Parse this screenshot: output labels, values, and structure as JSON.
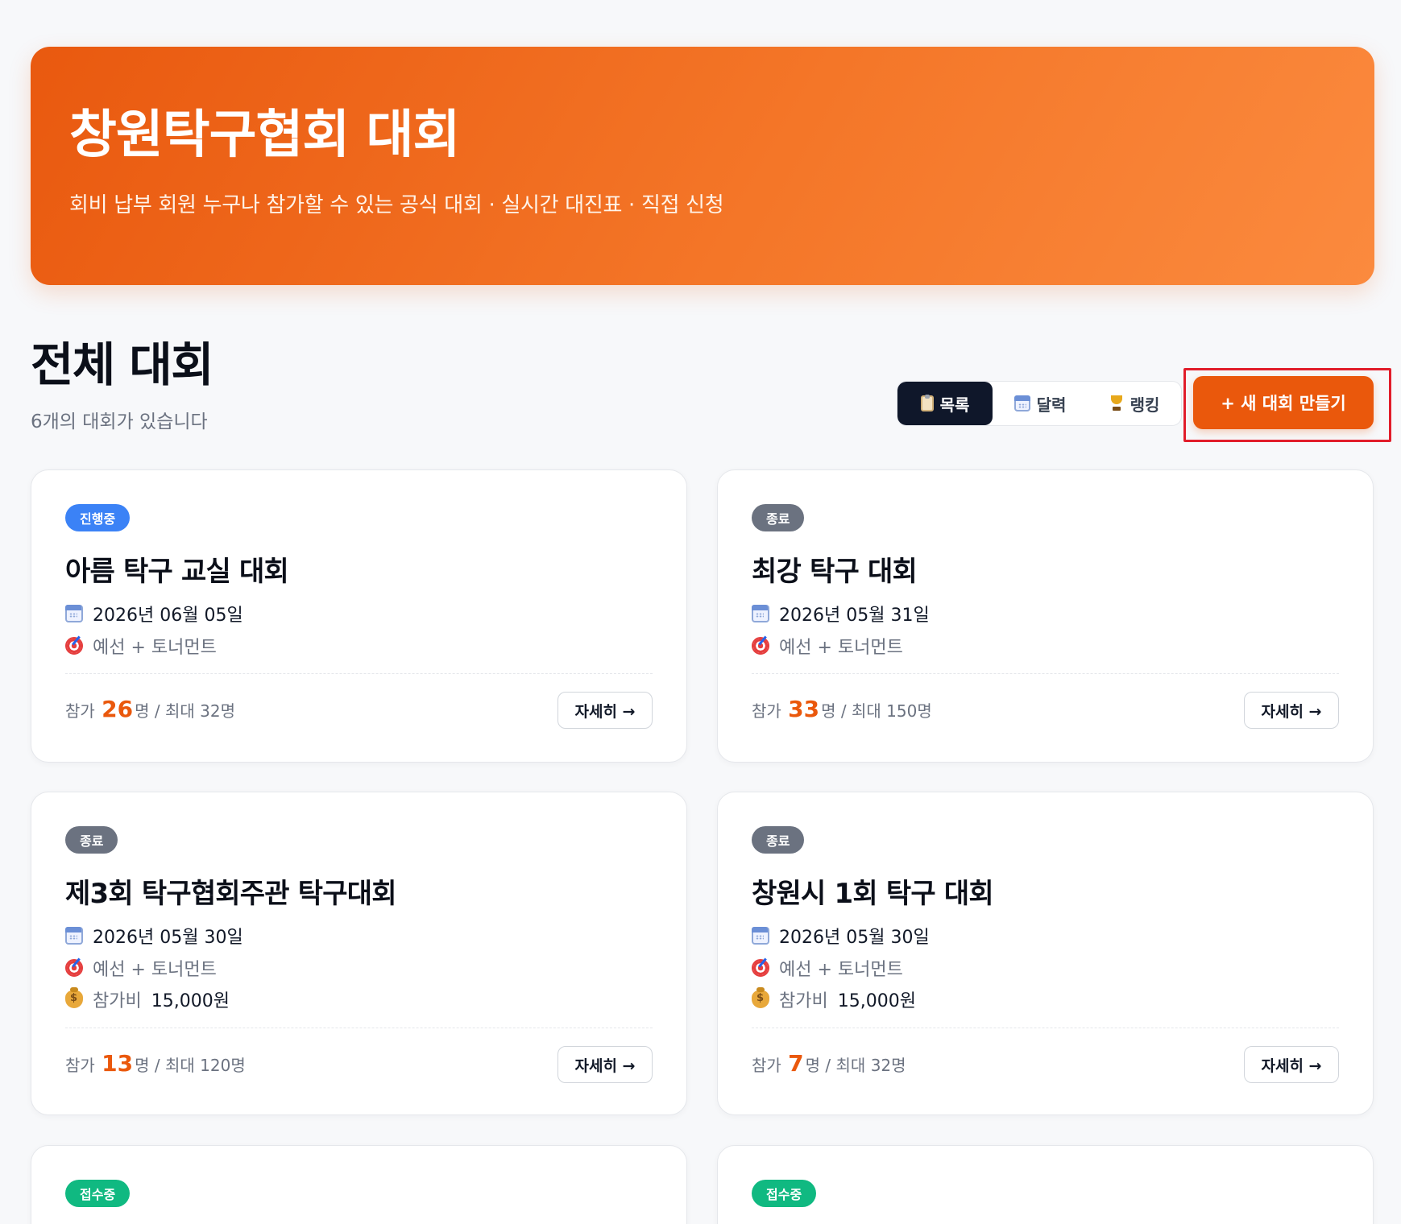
{
  "hero": {
    "title": "창원탁구협회 대회",
    "subtitle": "회비 납부 회원 누구나 참가할 수 있는 공식 대회 · 실시간 대진표 · 직접 신청"
  },
  "section": {
    "title": "전체 대회",
    "count_text": "6개의 대회가 있습니다"
  },
  "view_toggle": {
    "list_label": "목록",
    "calendar_label": "달력",
    "ranking_label": "랭킹",
    "active": "목록"
  },
  "new_button_label": "+ 새 대회 만들기",
  "labels": {
    "participants_prefix": "참가",
    "participants_suffix": "명",
    "max_prefix": "/ 최대",
    "fee_label": "참가비",
    "detail_label": "자세히 →"
  },
  "colors": {
    "accent": "#ea580c",
    "status_live": "#3b82f6",
    "status_done": "#6b7280",
    "status_open": "#10b981",
    "highlight": "#e11d2a"
  },
  "cards": [
    {
      "status": "진행중",
      "title": "아름 탁구 교실 대회",
      "date": "2026년 06월 05일",
      "format": "예선 + 토너먼트",
      "participants": "26",
      "max": "32명"
    },
    {
      "status": "종료",
      "title": "최강 탁구 대회",
      "date": "2026년 05월 31일",
      "format": "예선 + 토너먼트",
      "participants": "33",
      "max": "150명"
    },
    {
      "status": "종료",
      "title": "제3회 탁구협회주관 탁구대회",
      "date": "2026년 05월 30일",
      "format": "예선 + 토너먼트",
      "fee": "15,000원",
      "participants": "13",
      "max": "120명"
    },
    {
      "status": "종료",
      "title": "창원시 1회 탁구 대회",
      "date": "2026년 05월 30일",
      "format": "예선 + 토너먼트",
      "fee": "15,000원",
      "participants": "7",
      "max": "32명"
    },
    {
      "status": "접수중"
    },
    {
      "status": "접수중"
    }
  ]
}
